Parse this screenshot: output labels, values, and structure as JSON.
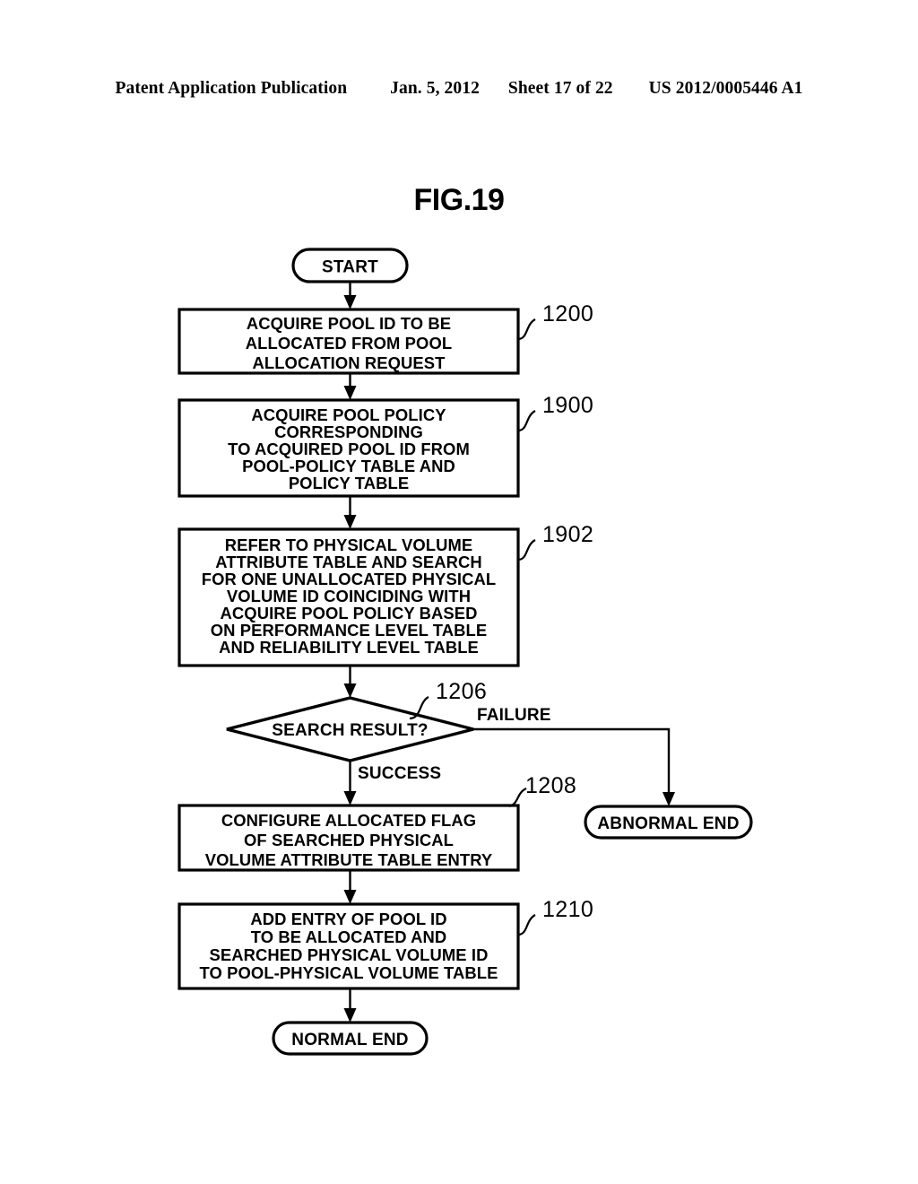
{
  "header": {
    "publication": "Patent Application Publication",
    "date": "Jan. 5, 2012",
    "sheet": "Sheet 17 of 22",
    "patent_number": "US 2012/0005446 A1"
  },
  "figure": {
    "title": "FIG.19"
  },
  "flowchart": {
    "start": {
      "label": "START"
    },
    "steps": [
      {
        "ref": "1200",
        "lines": [
          "ACQUIRE  POOL  ID  TO BE",
          "ALLOCATED  FROM  POOL",
          "ALLOCATION REQUEST"
        ]
      },
      {
        "ref": "1900",
        "lines": [
          "ACQUIRE  POOL  POLICY",
          "CORRESPONDING",
          "TO ACQUIRED POOL ID FROM",
          "POOL-POLICY TABLE AND",
          "POLICY TABLE"
        ]
      },
      {
        "ref": "1902",
        "lines": [
          "REFER TO PHYSICAL VOLUME",
          "ATTRIBUTE TABLE AND SEARCH",
          "FOR ONE UNALLOCATED PHYSICAL",
          "VOLUME   ID   COINCIDING   WITH",
          "ACQUIRE POOL POLICY BASED",
          "ON PERFORMANCE LEVEL TABLE",
          "AND RELIABILITY LEVEL TABLE"
        ]
      }
    ],
    "decision": {
      "ref": "1206",
      "label": "SEARCH RESULT?",
      "branch_failure": "FAILURE",
      "branch_success": "SUCCESS"
    },
    "abnormal_end": {
      "label": "ABNORMAL END"
    },
    "post_steps": [
      {
        "ref": "1208",
        "lines": [
          "CONFIGURE ALLOCATED FLAG",
          "OF SEARCHED PHYSICAL",
          "VOLUME ATTRIBUTE TABLE ENTRY"
        ]
      },
      {
        "ref": "1210",
        "lines": [
          "ADD ENTRY OF POOL ID",
          "TO BE  ALLOCATED AND",
          "SEARCHED PHYSICAL VOLUME ID",
          "TO POOL-PHYSICAL VOLUME TABLE"
        ]
      }
    ],
    "normal_end": {
      "label": "NORMAL END"
    }
  }
}
